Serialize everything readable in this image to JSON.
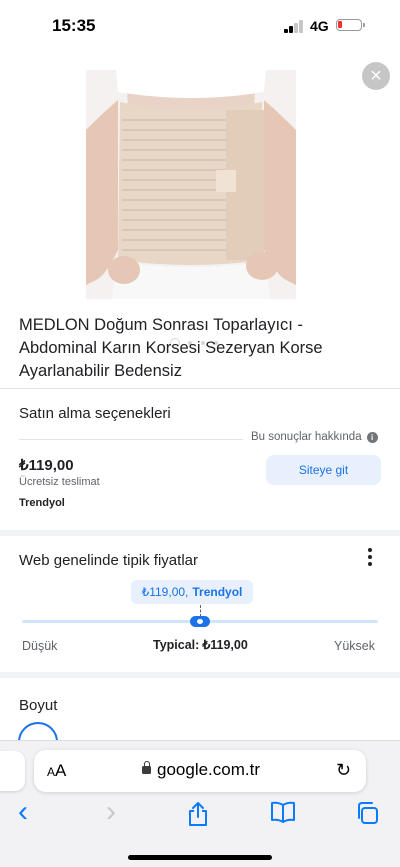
{
  "status_bar": {
    "time": "15:35",
    "network": "4G"
  },
  "product": {
    "title": "MEDLON Doğum Sonrası Toparlayıcı - Abdominal Karın Korsesi Sezeryan Korse Ayarlanabilir Bedensiz",
    "image_count": 4,
    "active_image": 1
  },
  "purchase": {
    "heading": "Satın alma seçenekleri",
    "about_results": "Bu sonuçlar hakkında",
    "info_glyph": "i",
    "price": "₺119,00",
    "shipping": "Ücretsiz teslimat",
    "seller": "Trendyol",
    "go_button": "Siteye git"
  },
  "typical_prices": {
    "heading": "Web genelinde tipik fiyatlar",
    "chip_price": "₺119,00,",
    "chip_seller": "Trendyol",
    "low_label": "Düşük",
    "high_label": "Yüksek",
    "typical_label": "Typical:",
    "typical_value": "₺119,00",
    "position_fraction": 0.5
  },
  "size": {
    "heading": "Boyut"
  },
  "safari": {
    "aa_big": "A",
    "aa_small": "A",
    "url": "google.com.tr",
    "reload_glyph": "↻",
    "back_glyph": "‹",
    "forward_glyph": "›",
    "close_glyph": "×"
  },
  "colors": {
    "accent": "#1a73e8",
    "accent_bg": "#e8f0fe",
    "ios_blue": "#0a7aff"
  }
}
